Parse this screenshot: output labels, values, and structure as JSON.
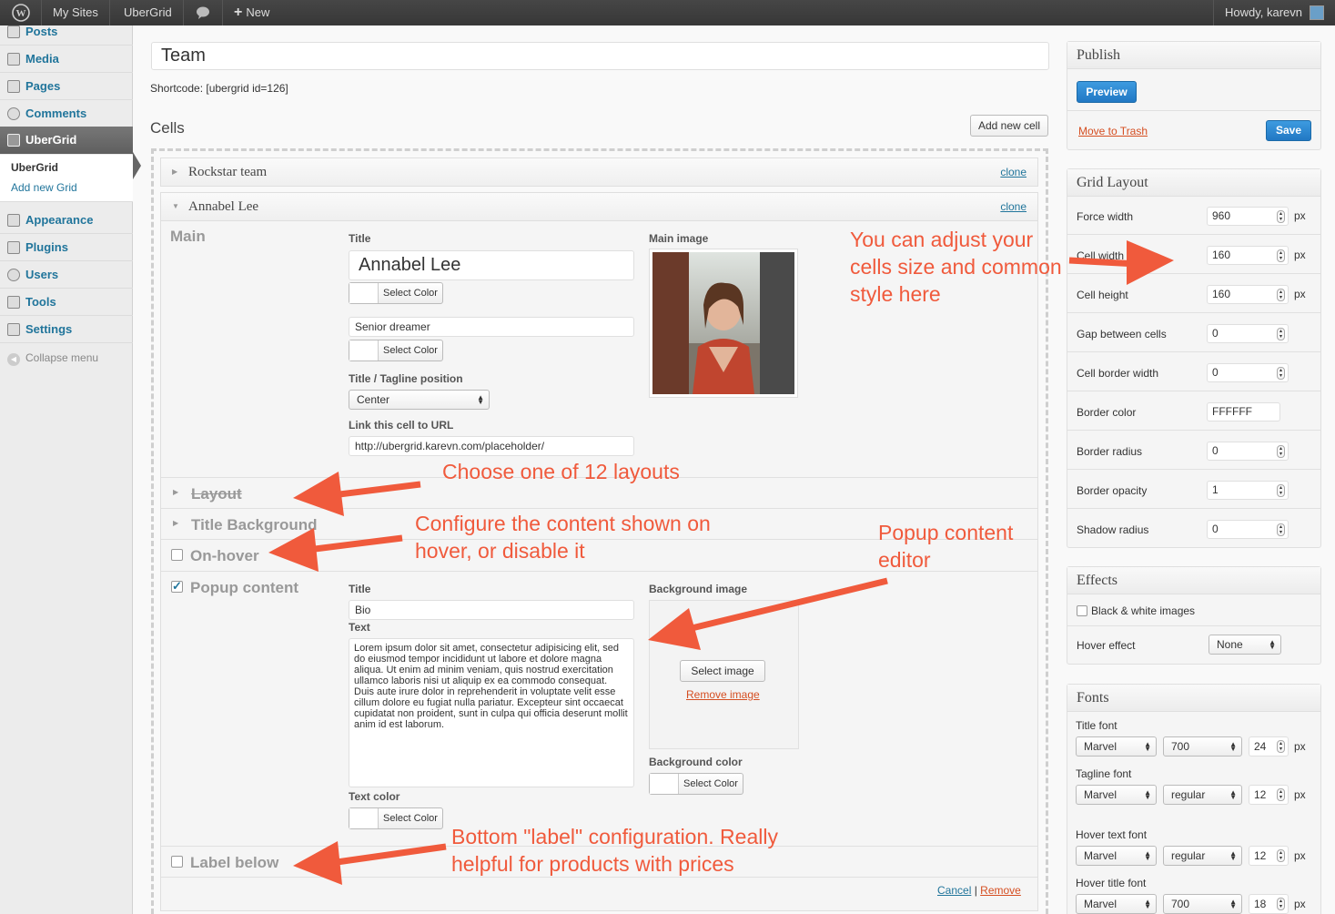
{
  "admin_bar": {
    "my_sites": "My Sites",
    "site_name": "UberGrid",
    "new_label": "New",
    "howdy": "Howdy, karevn"
  },
  "sidebar": {
    "items": [
      {
        "label": "Posts",
        "icon": "pin-icon"
      },
      {
        "label": "Media",
        "icon": "media-icon"
      },
      {
        "label": "Pages",
        "icon": "page-icon"
      },
      {
        "label": "Comments",
        "icon": "comment-icon"
      },
      {
        "label": "UberGrid",
        "icon": "pin-icon"
      },
      {
        "label": "Appearance",
        "icon": "appearance-icon"
      },
      {
        "label": "Plugins",
        "icon": "plugin-icon"
      },
      {
        "label": "Users",
        "icon": "users-icon"
      },
      {
        "label": "Tools",
        "icon": "tools-icon"
      },
      {
        "label": "Settings",
        "icon": "settings-icon"
      }
    ],
    "submenu": {
      "current": "UberGrid",
      "add_new": "Add new Grid"
    },
    "collapse": "Collapse menu"
  },
  "editor": {
    "grid_title": "Team",
    "shortcode": "Shortcode: [ubergrid id=126]",
    "cells_heading": "Cells",
    "add_cell_button": "Add new cell",
    "clone_label": "clone",
    "cells": [
      {
        "name": "Rockstar team"
      },
      {
        "name": "Annabel Lee"
      }
    ],
    "main": {
      "section_label": "Main",
      "title_label": "Title",
      "title_value": "Annabel Lee",
      "select_color": "Select Color",
      "tagline_value": "Senior dreamer",
      "position_label": "Title / Tagline position",
      "position_value": "Center",
      "link_label": "Link this cell to URL",
      "link_value": "http://ubergrid.karevn.com/placeholder/",
      "image_label": "Main image"
    },
    "sections": {
      "layout": "Layout",
      "title_background": "Title Background",
      "on_hover": "On-hover",
      "popup_content": "Popup content",
      "label_below": "Label below"
    },
    "popup": {
      "title_label": "Title",
      "title_value": "Bio",
      "text_label": "Text",
      "text_value": "Lorem ipsum dolor sit amet, consectetur adipisicing elit, sed do eiusmod tempor incididunt ut labore et dolore magna aliqua. Ut enim ad minim veniam, quis nostrud exercitation ullamco laboris nisi ut aliquip ex ea commodo consequat. Duis aute irure dolor in reprehenderit in voluptate velit esse cillum dolore eu fugiat nulla pariatur. Excepteur sint occaecat cupidatat non proident, sunt in culpa qui officia deserunt mollit anim id est laborum.",
      "text_color_label": "Text color",
      "bg_image_label": "Background image",
      "select_image": "Select image",
      "remove_image": "Remove image",
      "bg_color_label": "Background color",
      "select_color": "Select Color"
    },
    "footer": {
      "cancel": "Cancel",
      "separator": "|",
      "remove": "Remove"
    }
  },
  "publish": {
    "heading": "Publish",
    "preview": "Preview",
    "trash": "Move to Trash",
    "save": "Save"
  },
  "grid_layout": {
    "heading": "Grid Layout",
    "unit": "px",
    "rows": [
      {
        "label": "Force width",
        "value": "960",
        "unit": true
      },
      {
        "label": "Cell width",
        "value": "160",
        "unit": true
      },
      {
        "label": "Cell height",
        "value": "160",
        "unit": true
      },
      {
        "label": "Gap between cells",
        "value": "0",
        "unit": false
      },
      {
        "label": "Cell border width",
        "value": "0",
        "unit": false
      },
      {
        "label": "Border color",
        "value": "FFFFFF",
        "unit": false
      },
      {
        "label": "Border radius",
        "value": "0",
        "unit": false
      },
      {
        "label": "Border opacity",
        "value": "1",
        "unit": false
      },
      {
        "label": "Shadow radius",
        "value": "0",
        "unit": false
      }
    ]
  },
  "effects": {
    "heading": "Effects",
    "bw_label": "Black & white images",
    "hover_label": "Hover effect",
    "hover_value": "None"
  },
  "fonts": {
    "heading": "Fonts",
    "unit": "px",
    "groups": [
      {
        "label": "Title font",
        "family": "Marvel",
        "weight": "700",
        "size": "24"
      },
      {
        "label": "Tagline font",
        "family": "Marvel",
        "weight": "regular",
        "size": "12"
      },
      {
        "label": "Hover text font",
        "family": "Marvel",
        "weight": "regular",
        "size": "12"
      },
      {
        "label": "Hover title font",
        "family": "Marvel",
        "weight": "700",
        "size": "18"
      }
    ]
  },
  "annotations": {
    "size": "You can adjust your\ncells size and common\nstyle here",
    "layouts": "Choose one of 12 layouts",
    "hover": "Configure the content shown on\nhover, or disable it",
    "popup": "Popup content\neditor",
    "label": "Bottom \"label\" configuration. Really\nhelpful for products with prices"
  },
  "colors": {
    "accent": "#f05a3c",
    "link": "#21759b",
    "button_blue": "#2e8ad6"
  }
}
